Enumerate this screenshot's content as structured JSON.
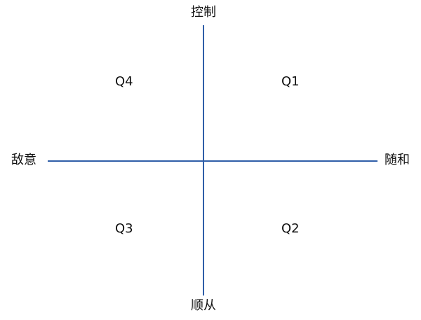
{
  "axes": {
    "top": "控制",
    "bottom": "顺从",
    "left": "敌意",
    "right": "随和"
  },
  "quadrants": {
    "q1": "Q1",
    "q2": "Q2",
    "q3": "Q3",
    "q4": "Q4"
  },
  "colors": {
    "axis": "#2f5ea8",
    "text": "#111111",
    "background": "#ffffff"
  }
}
